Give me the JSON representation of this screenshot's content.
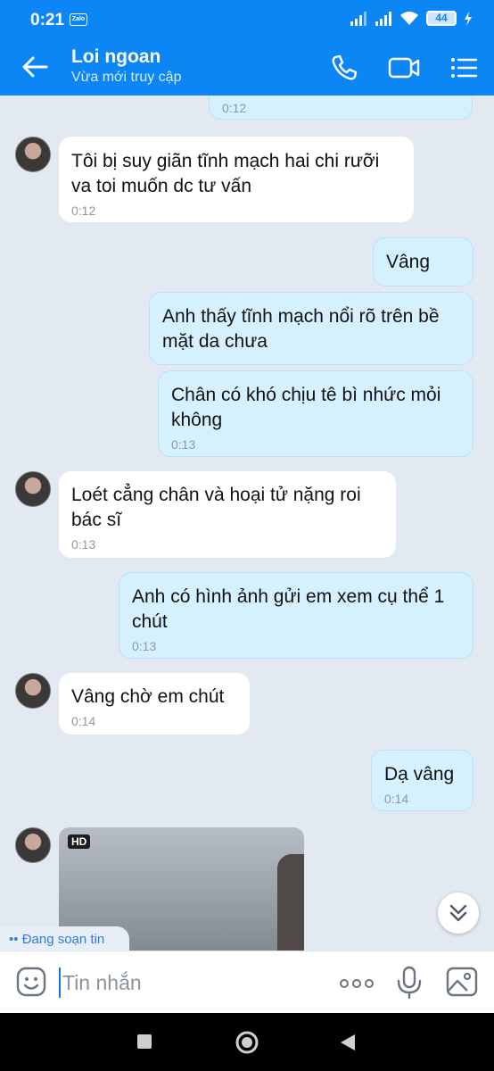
{
  "status_bar": {
    "time": "0:21",
    "app_badge": "Zalo",
    "battery": "44"
  },
  "header": {
    "contact_name": "Loi ngoan",
    "contact_status": "Vừa mới truy cập",
    "accent_color": "#0d86f5"
  },
  "messages": [
    {
      "direction": "out",
      "time": "0:12",
      "partial": true
    },
    {
      "direction": "in",
      "text": "Tôi bị suy giãn tĩnh mạch hai chi rưỡi va toi muốn dc tư vấn",
      "time": "0:12"
    },
    {
      "direction": "out",
      "text": "Vâng"
    },
    {
      "direction": "out",
      "text": "Anh thấy tĩnh mạch nổi rõ trên bề mặt da chưa"
    },
    {
      "direction": "out",
      "text": "Chân có khó chịu tê bì nhức mỏi không",
      "time": "0:13"
    },
    {
      "direction": "in",
      "text": "Loét cẳng chân và hoại tử nặng roi bác sĩ",
      "time": "0:13"
    },
    {
      "direction": "out",
      "text": "Anh có hình ảnh gửi em xem cụ thể 1 chút",
      "time": "0:13"
    },
    {
      "direction": "in",
      "text": "Vâng chờ em chút",
      "time": "0:14"
    },
    {
      "direction": "out",
      "text": "Dạ vâng",
      "time": "0:14"
    }
  ],
  "photo": {
    "badge": "HD"
  },
  "typing_indicator": "Đang soạn tin",
  "composer": {
    "placeholder": "Tin nhắn"
  }
}
